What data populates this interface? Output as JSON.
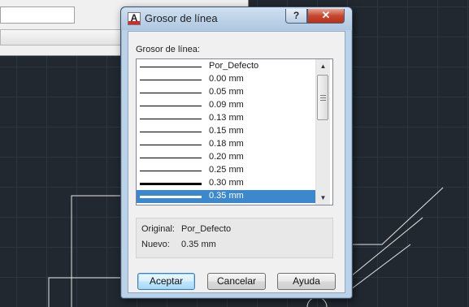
{
  "dialog": {
    "title": "Grosor de línea",
    "app_icon": "autocad-icon",
    "title_buttons": {
      "help": "?",
      "close": "✕"
    },
    "list_caption": "Grosor de línea:",
    "items": [
      {
        "label": "Por_Defecto",
        "weight": 1
      },
      {
        "label": "0.00 mm",
        "weight": 1
      },
      {
        "label": "0.05 mm",
        "weight": 1
      },
      {
        "label": "0.09 mm",
        "weight": 1
      },
      {
        "label": "0.13 mm",
        "weight": 1
      },
      {
        "label": "0.15 mm",
        "weight": 1
      },
      {
        "label": "0.18 mm",
        "weight": 1
      },
      {
        "label": "0.20 mm",
        "weight": 1
      },
      {
        "label": "0.25 mm",
        "weight": 1
      },
      {
        "label": "0.30 mm",
        "weight": 3
      },
      {
        "label": "0.35 mm",
        "weight": 3
      }
    ],
    "selected_index": 10,
    "info": {
      "original_label": "Original:",
      "original_value": "Por_Defecto",
      "new_label": "Nuevo:",
      "new_value": "0.35 mm"
    },
    "buttons": {
      "ok": "Aceptar",
      "cancel": "Cancelar",
      "help": "Ayuda"
    }
  },
  "colors": {
    "selection": "#3c88cc",
    "canvas": "#212830",
    "close_button": "#c8462f"
  }
}
